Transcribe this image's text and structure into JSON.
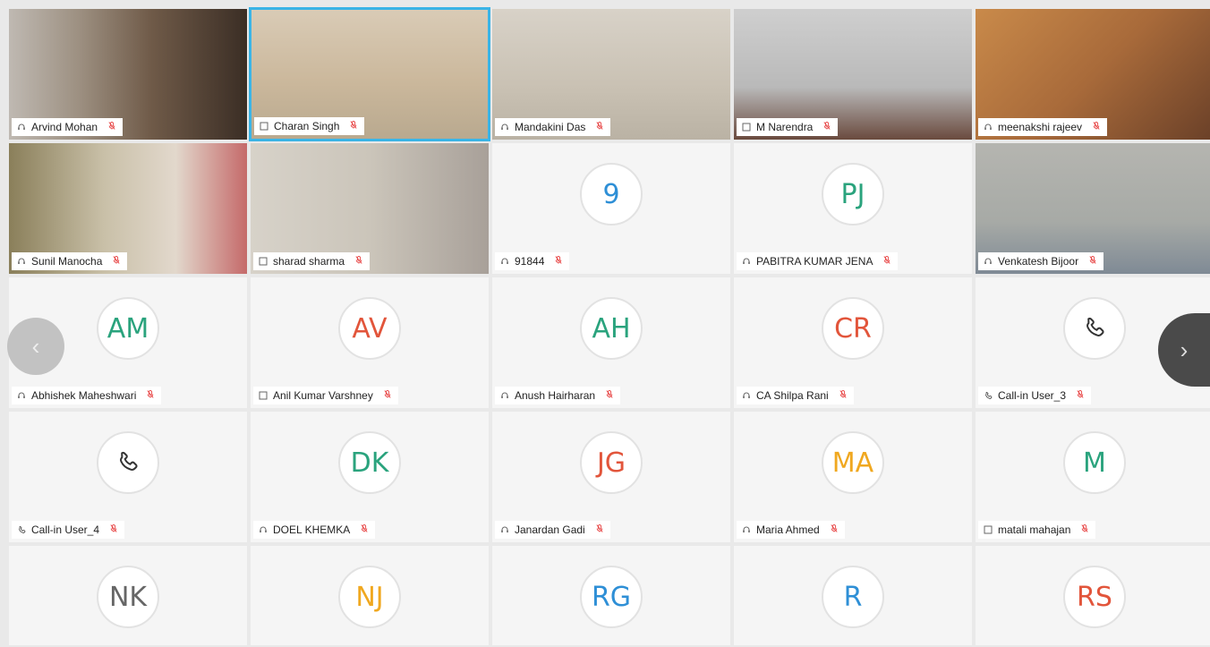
{
  "navigation": {
    "prev_symbol": "‹",
    "next_symbol": "›"
  },
  "participants": [
    {
      "name": "Arvind Mohan",
      "type": "video",
      "device": "headset"
    },
    {
      "name": "Charan Singh",
      "type": "video",
      "device": "desktop",
      "active": true
    },
    {
      "name": "Mandakini Das",
      "type": "video",
      "device": "headset"
    },
    {
      "name": "M Narendra",
      "type": "video",
      "device": "desktop"
    },
    {
      "name": "meenakshi rajeev",
      "type": "video",
      "device": "headset"
    },
    {
      "name": "Sunil Manocha",
      "type": "video",
      "device": "headset"
    },
    {
      "name": "sharad sharma",
      "type": "video",
      "device": "desktop"
    },
    {
      "name": "91844",
      "type": "avatar",
      "initials": "9",
      "color": "#2e8fd6",
      "device": "headset"
    },
    {
      "name": "PABITRA KUMAR JENA",
      "type": "avatar",
      "initials": "PJ",
      "color": "#2aa37d",
      "device": "headset"
    },
    {
      "name": "Venkatesh Bijoor",
      "type": "video",
      "device": "headset"
    },
    {
      "name": "Abhishek Maheshwari",
      "type": "avatar",
      "initials": "AM",
      "color": "#2aa37d",
      "device": "headset"
    },
    {
      "name": "Anil Kumar Varshney",
      "type": "avatar",
      "initials": "AV",
      "color": "#e2553b",
      "device": "desktop"
    },
    {
      "name": "Anush Hairharan",
      "type": "avatar",
      "initials": "AH",
      "color": "#2aa37d",
      "device": "headset"
    },
    {
      "name": "CA Shilpa Rani",
      "type": "avatar",
      "initials": "CR",
      "color": "#e2553b",
      "device": "headset"
    },
    {
      "name": "Call-in User_3",
      "type": "phone",
      "device": "phone"
    },
    {
      "name": "Call-in User_4",
      "type": "phone",
      "device": "phone"
    },
    {
      "name": "DOEL KHEMKA",
      "type": "avatar",
      "initials": "DK",
      "color": "#2aa37d",
      "device": "headset"
    },
    {
      "name": "Janardan Gadi",
      "type": "avatar",
      "initials": "JG",
      "color": "#e2553b",
      "device": "headset"
    },
    {
      "name": "Maria Ahmed",
      "type": "avatar",
      "initials": "MA",
      "color": "#f0a820",
      "device": "headset"
    },
    {
      "name": "matali mahajan",
      "type": "avatar",
      "initials": "M",
      "color": "#2aa37d",
      "device": "desktop"
    },
    {
      "name": "",
      "type": "avatar",
      "initials": "NK",
      "color": "#666666",
      "device": "headset"
    },
    {
      "name": "",
      "type": "avatar",
      "initials": "NJ",
      "color": "#f0a820",
      "device": "headset"
    },
    {
      "name": "",
      "type": "avatar",
      "initials": "RG",
      "color": "#2e8fd6",
      "device": "headset"
    },
    {
      "name": "",
      "type": "avatar",
      "initials": "R",
      "color": "#2e8fd6",
      "device": "headset"
    },
    {
      "name": "",
      "type": "avatar",
      "initials": "RS",
      "color": "#e2553b",
      "device": "headset"
    }
  ]
}
